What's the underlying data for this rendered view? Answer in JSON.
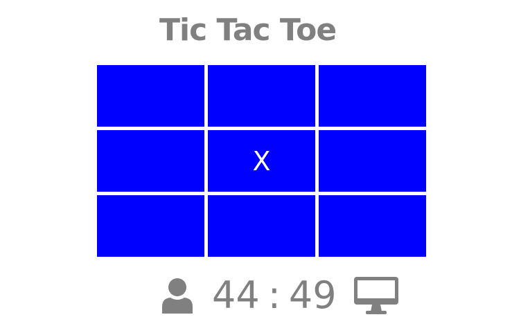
{
  "game": {
    "title": "Tic Tac Toe",
    "board": [
      [
        "",
        "",
        ""
      ],
      [
        "",
        "X",
        ""
      ],
      [
        "",
        "",
        ""
      ]
    ],
    "colors": {
      "cell_background": "#0000ff",
      "mark": "#ffffff",
      "text": "#808080"
    }
  },
  "score": {
    "player_icon": "user-icon",
    "player_score": "44",
    "separator": ":",
    "computer_score": "49",
    "computer_icon": "desktop-monitor-icon"
  }
}
